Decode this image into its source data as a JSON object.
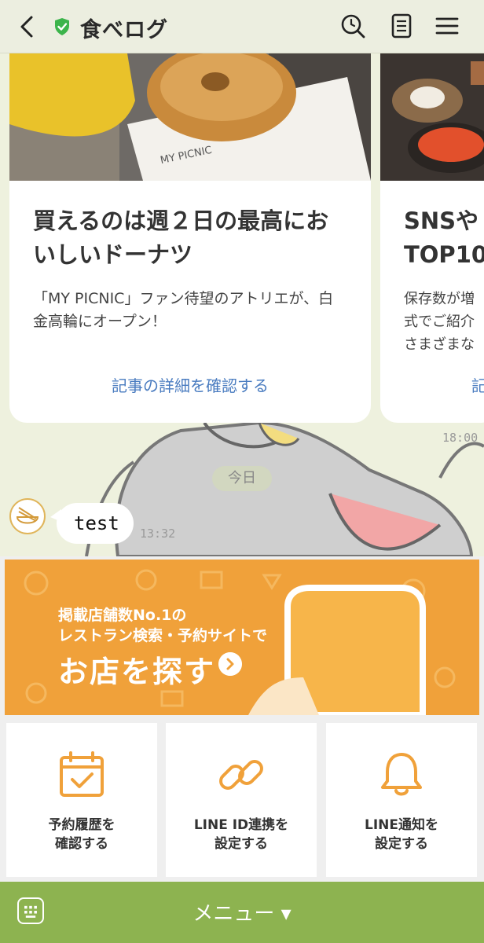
{
  "header": {
    "title": "食べログ",
    "icons": [
      "back-arrow-icon",
      "verified-shield-icon",
      "search-icon",
      "notes-icon",
      "hamburger-menu-icon"
    ],
    "shield_color": "#3cb44b"
  },
  "chat": {
    "cards": [
      {
        "title": "買えるのは週２日の最高においしいドーナツ",
        "description": "「MY PICNIC」ファン待望のアトリエが、白金高輪にオープン！",
        "link": "記事の詳細を確認する",
        "image_text": "MY PICNIC"
      },
      {
        "title_line1": "SNSや",
        "title_line2": "TOP10",
        "desc_line1": "保存数が増",
        "desc_line2": "式でご紹介",
        "desc_line3": "さまざまな",
        "link": "記"
      }
    ],
    "card_time": "18:00",
    "date_separator": "今日",
    "message": {
      "text": "test",
      "time": "13:32"
    }
  },
  "rich_menu": {
    "banner": {
      "line1": "掲載店舗数No.1の",
      "line2": "レストラン検索・予約サイトで",
      "cta": "お店を探す",
      "color": "#f0a13a"
    },
    "tiles": [
      {
        "line1": "予約履歴を",
        "line2": "確認する",
        "icon": "calendar-check-icon"
      },
      {
        "line1": "LINE ID連携を",
        "line2": "設定する",
        "icon": "link-chain-icon"
      },
      {
        "line1": "LINE通知を",
        "line2": "設定する",
        "icon": "bell-icon"
      }
    ],
    "accent": "#f0a13a"
  },
  "menu_bar": {
    "label": "メニュー ▾",
    "color": "#8db350"
  }
}
